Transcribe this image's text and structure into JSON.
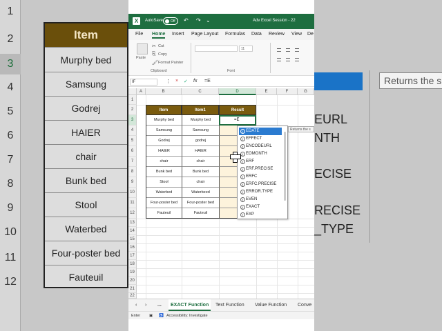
{
  "bg_left": {
    "row_numbers": [
      "1",
      "2",
      "3",
      "4",
      "5",
      "6",
      "7",
      "8",
      "9",
      "10",
      "11",
      "12"
    ],
    "header": "Item",
    "items": [
      "Murphy bed",
      "Samsung",
      "Godrej",
      "HAIER",
      "chair",
      "Bunk bed",
      "Stool",
      "Waterbed",
      "Four-poster bed",
      "Fauteuil"
    ]
  },
  "bg_right": {
    "tooltip": "Returns the s",
    "lines": [
      "EURL",
      "NTH",
      "ECISE",
      "RECISE",
      "_TYPE"
    ]
  },
  "titlebar": {
    "autosave_label": "AutoSave",
    "toggle_state": "Off",
    "title": "Adv Excel Session - 22"
  },
  "menu": {
    "items": [
      "File",
      "Home",
      "Insert",
      "Page Layout",
      "Formulas",
      "Data",
      "Review",
      "View",
      "De"
    ]
  },
  "ribbon": {
    "paste": "Paste",
    "cut": "Cut",
    "copy": "Copy",
    "format_painter": "Format Painter",
    "clipboard_group": "Clipboard",
    "font_size": "11",
    "font_group": "Font"
  },
  "formula_bar": {
    "name_box": "IF",
    "cancel_icon": "×",
    "enter_icon": "✓",
    "fx": "fx",
    "formula": "=E"
  },
  "columns": [
    "A",
    "B",
    "C",
    "D",
    "E",
    "F",
    "G"
  ],
  "rows": [
    "1",
    "2",
    "3",
    "4",
    "5",
    "6",
    "7",
    "8",
    "9",
    "10",
    "11",
    "12",
    "13",
    "14",
    "15",
    "16",
    "17",
    "18",
    "19",
    "20",
    "21",
    "22"
  ],
  "table": {
    "headers": [
      "Item",
      "Item1",
      "Result"
    ],
    "rows": [
      [
        "Murphy bed",
        "Murphy bed"
      ],
      [
        "Samsung",
        "Samsung"
      ],
      [
        "Godrej",
        "godrej"
      ],
      [
        "HAIER",
        "HAIER"
      ],
      [
        "chair",
        "chair"
      ],
      [
        "Bunk bed",
        "Bunk bed"
      ],
      [
        "Stool",
        "chair"
      ],
      [
        "Waterbed",
        "Waterbeed"
      ],
      [
        "Four-poster bed",
        "Four-poster bed"
      ],
      [
        "Fauteuil",
        "Fauteuil"
      ]
    ],
    "active_cell_value": "=E"
  },
  "autocomplete": {
    "items": [
      "EDATE",
      "EFFECT",
      "ENCODEURL",
      "EOMONTH",
      "ERF",
      "ERF.PRECISE",
      "ERFC",
      "ERFC.PRECISE",
      "ERROR.TYPE",
      "EVEN",
      "EXACT",
      "EXP"
    ],
    "selected_index": 0,
    "tooltip": "Returns the s"
  },
  "sheet_tabs": {
    "more": "...",
    "tabs": [
      "EXACT Function",
      "Text Function",
      "Value Function",
      "Conve"
    ],
    "active_index": 0
  },
  "status_bar": {
    "mode": "Enter",
    "accessibility": "Accessibility: Investigate"
  },
  "colors": {
    "excel_green": "#1e6e40",
    "table_header": "#7a5b0e",
    "selection_blue": "#2b7bd0"
  }
}
